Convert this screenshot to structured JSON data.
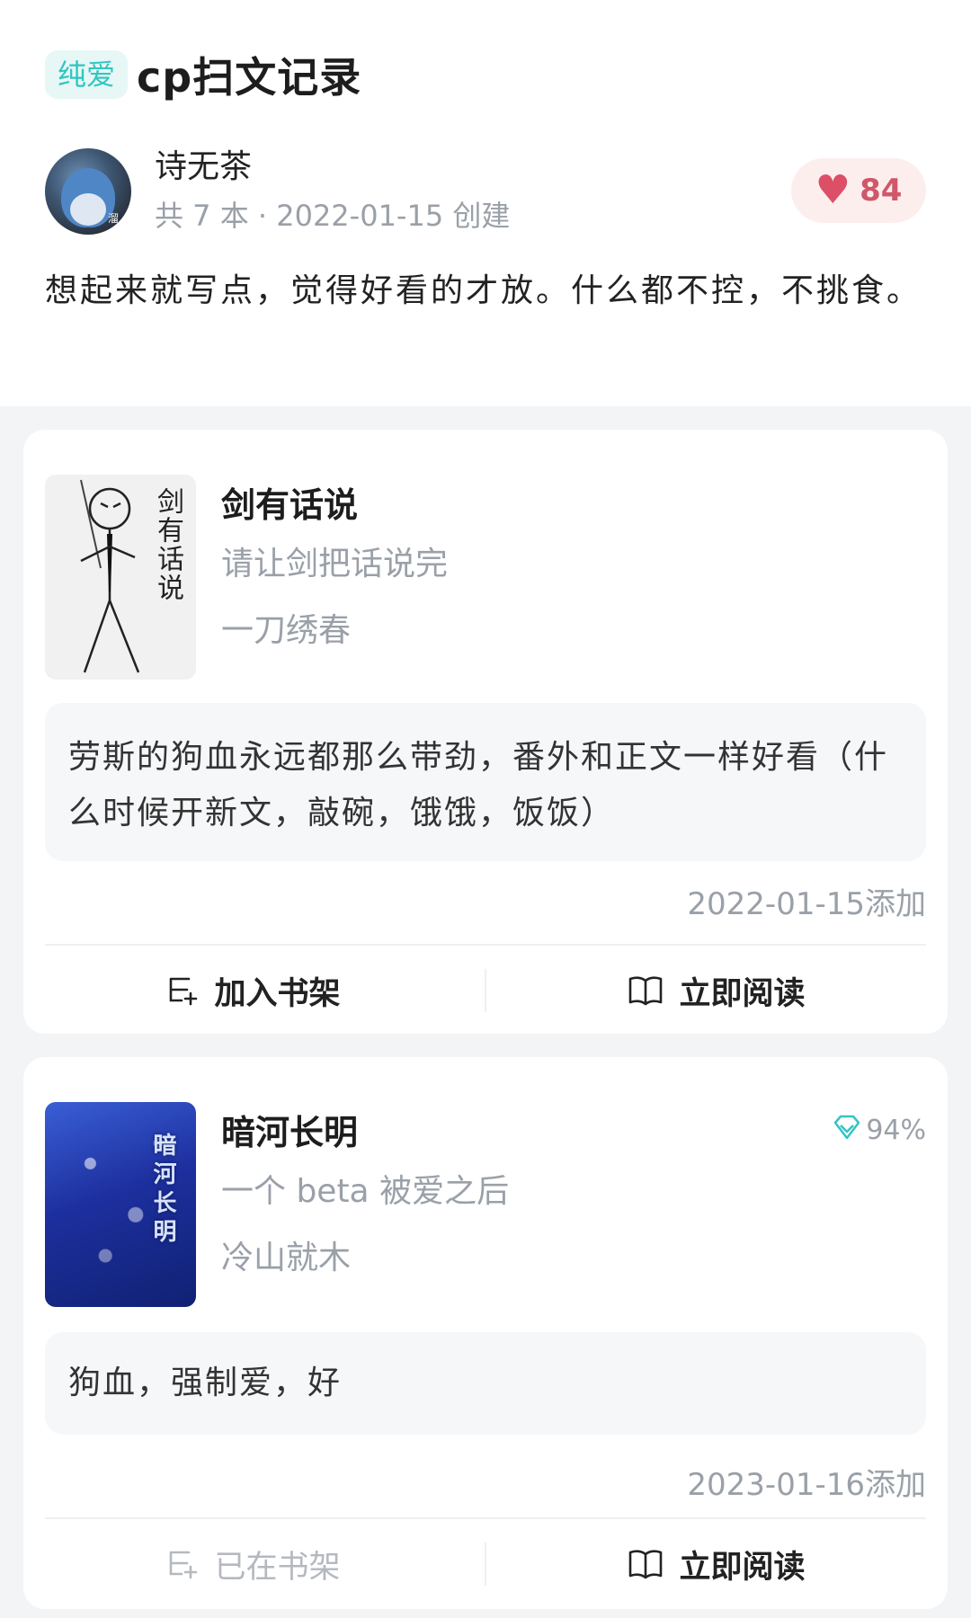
{
  "header": {
    "tag": "纯爱",
    "title": "cp扫文记录",
    "author": {
      "name": "诗无茶",
      "meta": "共 7 本 · 2022-01-15 创建",
      "avatar_stamp": "溜"
    },
    "like": {
      "icon": "heart-icon",
      "count": "84"
    },
    "description": "想起来就写点，觉得好看的才放。什么都不控，不挑食。"
  },
  "books": [
    {
      "cover_text": "剑有话说",
      "title": "剑有话说",
      "subtitle": "请让剑把话说完",
      "author": "一刀绣春",
      "rating": "",
      "review": "劳斯的狗血永远都那么带劲，番外和正文一样好看（什么时候开新文，敲碗，饿饿，饭饭）",
      "added": "2022-01-15添加",
      "shelf_label": "加入书架",
      "read_label": "立即阅读"
    },
    {
      "cover_text": "暗河长明",
      "title": "暗河长明",
      "subtitle": "一个 beta 被爱之后",
      "author": "冷山就木",
      "rating": "94%",
      "review": "狗血，强制爱，好",
      "added": "2023-01-16添加",
      "shelf_label": "已在书架",
      "read_label": "立即阅读"
    }
  ],
  "colors": {
    "accent_teal": "#2fc6c0",
    "like_red": "#dd4f67",
    "muted_gray": "#9aa0a8"
  }
}
